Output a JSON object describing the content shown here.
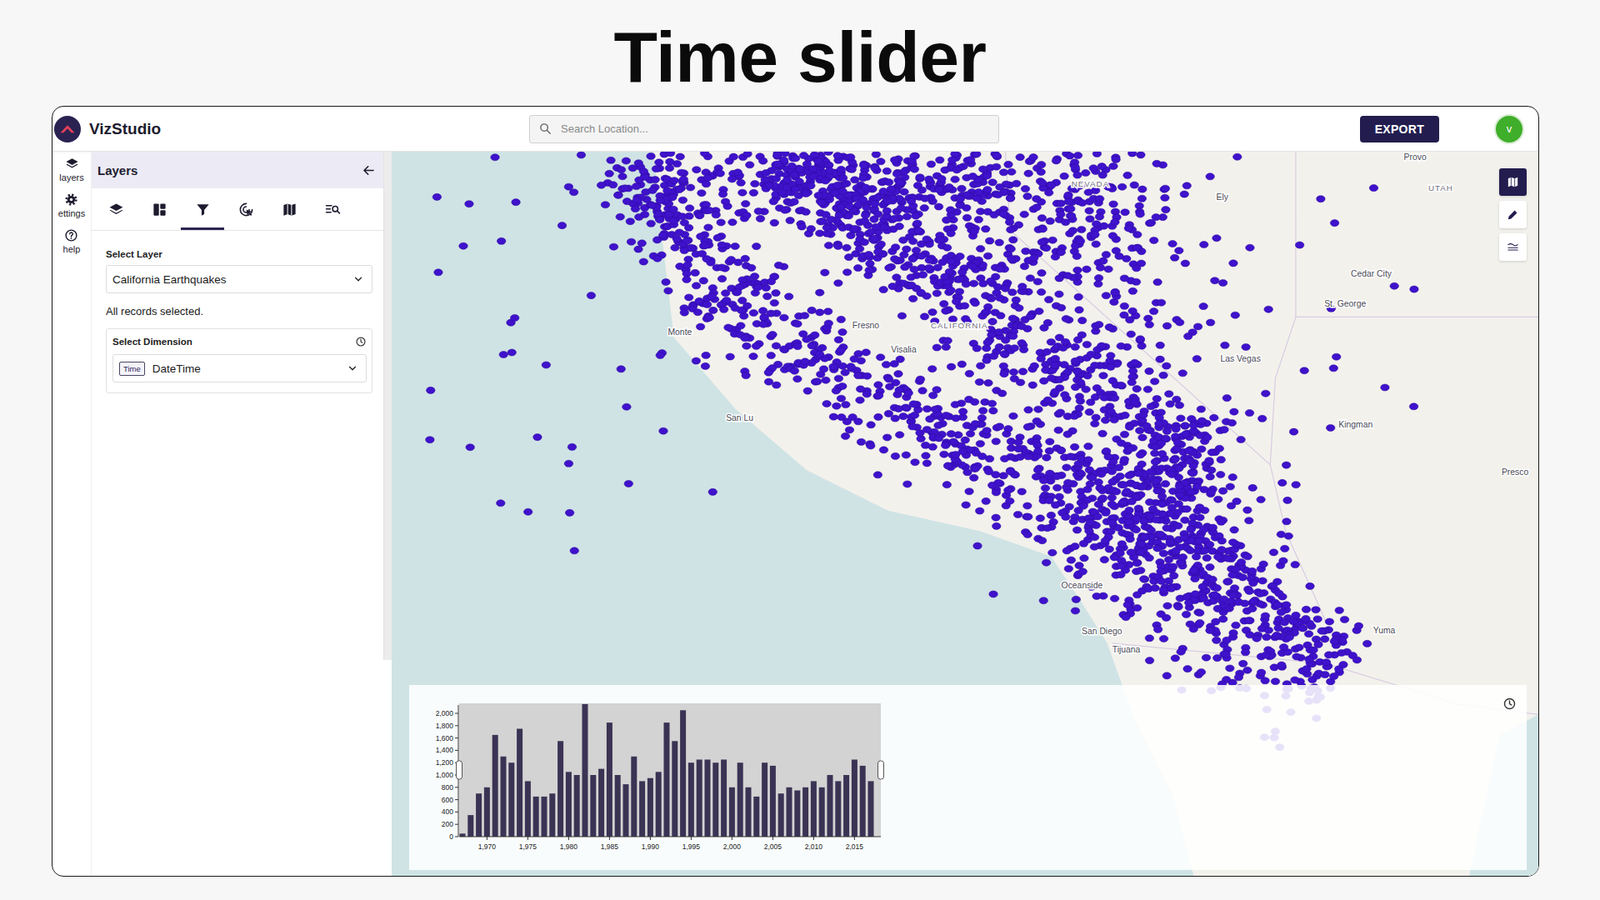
{
  "page_title": "Time slider",
  "app": {
    "name": "VizStudio"
  },
  "search": {
    "placeholder": "Search Location..."
  },
  "header_buttons": [
    {
      "label": "EXPORT"
    }
  ],
  "user": {
    "initial": "v"
  },
  "rail": [
    {
      "kind": "layers",
      "label": "layers"
    },
    {
      "kind": "settings",
      "label": "ettings"
    },
    {
      "kind": "help",
      "label": "help"
    }
  ],
  "panel": {
    "title": "Layers",
    "tabs": [
      {
        "kind": "layers",
        "selected": false
      },
      {
        "kind": "widgets",
        "selected": false
      },
      {
        "kind": "filter",
        "selected": true
      },
      {
        "kind": "interactions",
        "selected": false
      },
      {
        "kind": "basemap",
        "selected": false
      },
      {
        "kind": "search-list",
        "selected": false
      }
    ],
    "select_layer_label": "Select Layer",
    "layer": "California Earthquakes",
    "status": "All records selected.",
    "dimension": {
      "label": "Select Dimension",
      "badge": "Time",
      "value": "DateTime"
    }
  },
  "map": {
    "labels": [
      {
        "text": "NEVADA",
        "kind": "region"
      },
      {
        "text": "UTAH",
        "kind": "region"
      },
      {
        "text": "Provo",
        "kind": "city"
      },
      {
        "text": "Ely",
        "kind": "city"
      },
      {
        "text": "Cedar City",
        "kind": "city"
      },
      {
        "text": "St. George",
        "kind": "city"
      },
      {
        "text": "Las Vegas",
        "kind": "city"
      },
      {
        "text": "Kingman",
        "kind": "city"
      },
      {
        "text": "Presco",
        "kind": "city"
      },
      {
        "text": "Yuma",
        "kind": "city"
      },
      {
        "text": "Oceanside",
        "kind": "city"
      },
      {
        "text": "San Diego",
        "kind": "city"
      },
      {
        "text": "Tijuana",
        "kind": "city"
      },
      {
        "text": "CALIFORNIA",
        "kind": "region"
      },
      {
        "text": "Fresno",
        "kind": "city"
      },
      {
        "text": "Visalia",
        "kind": "city"
      },
      {
        "text": "San Lu",
        "kind": "city"
      },
      {
        "text": "Monte",
        "kind": "city"
      }
    ],
    "tools": [
      {
        "kind": "map",
        "selected": true
      },
      {
        "kind": "draw",
        "selected": false
      },
      {
        "kind": "legend",
        "selected": false
      }
    ]
  },
  "time_slider": {
    "y_ticks": [
      "0",
      "200",
      "400",
      "600",
      "800",
      "1,000",
      "1,200",
      "1,400",
      "1,600",
      "1,800",
      "2,000"
    ],
    "x_ticks": [
      "1,970",
      "1,975",
      "1,980",
      "1,985",
      "1,990",
      "1,995",
      "2,000",
      "2,005",
      "2,010",
      "2,015"
    ],
    "series": [
      {
        "name": "earthquakes",
        "values": [
          50,
          350,
          700,
          800,
          1650,
          1300,
          1200,
          1750,
          900,
          650,
          650,
          700,
          1550,
          1050,
          1000,
          2150,
          1000,
          1100,
          1850,
          1000,
          850,
          1300,
          900,
          950,
          1050,
          1850,
          1550,
          2050,
          1200,
          1250,
          1250,
          1200,
          1250,
          800,
          1200,
          800,
          650,
          1200,
          1150,
          700,
          800,
          750,
          800,
          900,
          800,
          1000,
          900,
          1000,
          1250,
          1150,
          900
        ]
      }
    ],
    "selection": {
      "start": 0,
      "end": 1
    }
  }
}
